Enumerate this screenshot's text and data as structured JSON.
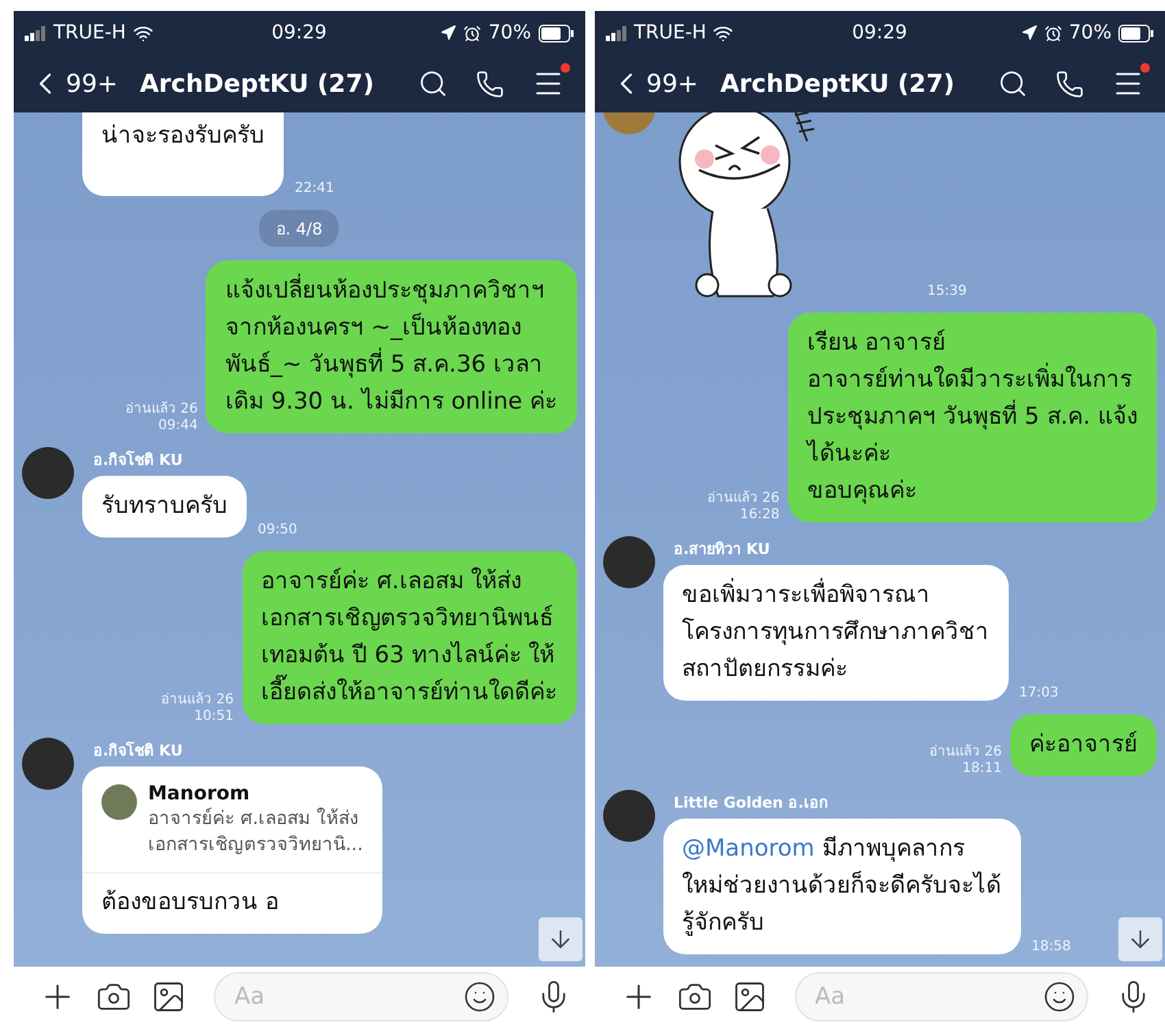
{
  "panels": [
    {
      "status": {
        "carrier": "TRUE-H",
        "time": "09:29",
        "battery": "70%"
      },
      "header": {
        "back_count": "99+",
        "title": "ArchDeptKU (27)",
        "menu_badge": true
      },
      "messages": [
        {
          "kind": "incoming",
          "cut_top": true,
          "show_avatar": false,
          "lines": [
            "น่าจะรองรับครับ"
          ],
          "time": "22:41"
        },
        {
          "kind": "date",
          "text": "อ. 4/8"
        },
        {
          "kind": "outgoing",
          "lines": [
            "แจ้งเปลี่ยนห้องประชุมภาควิชาฯ",
            "จากห้องนครฯ  ~_เป็นห้องทอง",
            "พันธ์_~ วันพุธที่ 5 ส.ค.36  เวลา",
            "เดิม 9.30 น. ไม่มีการ online ค่ะ"
          ],
          "read": "อ่านแล้ว 26",
          "time": "09:44"
        },
        {
          "kind": "incoming",
          "show_avatar": true,
          "sender": "อ.กิจโชติ KU",
          "lines": [
            "รับทราบครับ"
          ],
          "time": "09:50"
        },
        {
          "kind": "outgoing",
          "lines": [
            "อาจารย์ค่ะ ศ.เลอสม ให้ส่ง",
            "เอกสารเชิญตรวจวิทยานิพนธ์",
            "เทอมต้น ปี 63 ทางไลน์ค่ะ ให้",
            "เอี๊ยดส่งให้อาจารย์ท่านใดดีค่ะ"
          ],
          "read": "อ่านแล้ว 26",
          "time": "10:51"
        },
        {
          "kind": "reply",
          "show_avatar": true,
          "sender": "อ.กิจโชติ KU",
          "quote_name": "Manorom",
          "quote_lines": [
            "อาจารย์ค่ะ ศ.เลอสม ให้ส่ง",
            "เอกสารเชิญตรวจวิทยานิ..."
          ],
          "lines": [
            "ต้องขอบรบกวน อ"
          ]
        }
      ],
      "input": {
        "placeholder": "Aa"
      }
    },
    {
      "status": {
        "carrier": "TRUE-H",
        "time": "09:29",
        "battery": "70%"
      },
      "header": {
        "back_count": "99+",
        "title": "ArchDeptKU (27)",
        "menu_badge": true
      },
      "messages": [
        {
          "kind": "sticker",
          "time": "15:39"
        },
        {
          "kind": "outgoing",
          "lines": [
            "เรียน อาจารย์",
            "อาจารย์ท่านใดมีวาระเพิ่มในการ",
            "ประชุมภาคฯ วันพุธที่ 5 ส.ค. แจ้ง",
            "ได้นะค่ะ",
            "ขอบคุณค่ะ"
          ],
          "read": "อ่านแล้ว 26",
          "time": "16:28"
        },
        {
          "kind": "incoming",
          "show_avatar": true,
          "sender": "อ.สายทิวา KU",
          "lines": [
            "ขอเพิ่มวาระเพื่อพิจารณา",
            "โครงการทุนการศึกษาภาควิชา",
            "สถาปัตยกรรมค่ะ"
          ],
          "time": "17:03"
        },
        {
          "kind": "outgoing",
          "lines": [
            "ค่ะอาจารย์"
          ],
          "read": "อ่านแล้ว 26",
          "time": "18:11"
        },
        {
          "kind": "incoming",
          "show_avatar": true,
          "sender": "Little Golden อ.เอก",
          "mention": "@Manorom",
          "lines": [
            "มีภาพบุคลากร",
            "ใหม่ช่วยงานด้วยก็จะดีครับจะได้",
            "รู้จักครับ"
          ],
          "time": "18:58"
        }
      ],
      "input": {
        "placeholder": "Aa"
      }
    }
  ]
}
